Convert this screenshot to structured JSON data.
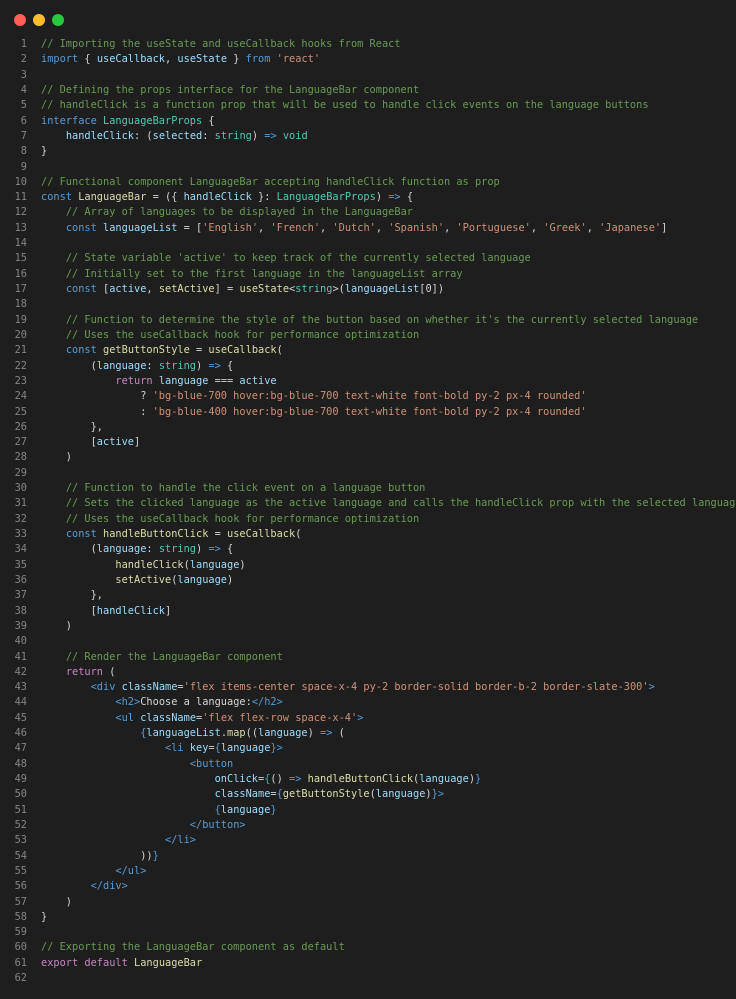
{
  "window": {
    "controls": [
      {
        "name": "close",
        "color": "#ff5f57"
      },
      {
        "name": "minimize",
        "color": "#febc2e"
      },
      {
        "name": "zoom",
        "color": "#28c840"
      }
    ]
  },
  "code": {
    "lines": [
      {
        "n": "1",
        "t": [
          [
            "c",
            "// Importing the useState and useCallback hooks from React"
          ]
        ]
      },
      {
        "n": "2",
        "t": [
          [
            "k",
            "import"
          ],
          [
            "p",
            " { "
          ],
          [
            "v",
            "useCallback"
          ],
          [
            "p",
            ", "
          ],
          [
            "v",
            "useState"
          ],
          [
            "p",
            " } "
          ],
          [
            "k",
            "from"
          ],
          [
            "p",
            " "
          ],
          [
            "s",
            "'react'"
          ]
        ]
      },
      {
        "n": "3",
        "t": []
      },
      {
        "n": "4",
        "t": [
          [
            "c",
            "// Defining the props interface for the LanguageBar component"
          ]
        ]
      },
      {
        "n": "5",
        "t": [
          [
            "c",
            "// handleClick is a function prop that will be used to handle click events on the language buttons"
          ]
        ]
      },
      {
        "n": "6",
        "t": [
          [
            "k",
            "interface"
          ],
          [
            "p",
            " "
          ],
          [
            "y",
            "LanguageBarProps"
          ],
          [
            "p",
            " {"
          ]
        ]
      },
      {
        "n": "7",
        "t": [
          [
            "p",
            "    "
          ],
          [
            "v",
            "handleClick"
          ],
          [
            "p",
            ": ("
          ],
          [
            "v",
            "selected"
          ],
          [
            "p",
            ": "
          ],
          [
            "y",
            "string"
          ],
          [
            "p",
            ") "
          ],
          [
            "k",
            "=>"
          ],
          [
            "p",
            " "
          ],
          [
            "y",
            "void"
          ]
        ]
      },
      {
        "n": "8",
        "t": [
          [
            "p",
            "}"
          ]
        ]
      },
      {
        "n": "9",
        "t": []
      },
      {
        "n": "10",
        "t": [
          [
            "c",
            "// Functional component LanguageBar accepting handleClick function as prop"
          ]
        ]
      },
      {
        "n": "11",
        "t": [
          [
            "k",
            "const"
          ],
          [
            "p",
            " "
          ],
          [
            "f",
            "LanguageBar"
          ],
          [
            "p",
            " = ({ "
          ],
          [
            "v",
            "handleClick"
          ],
          [
            "p",
            " }: "
          ],
          [
            "y",
            "LanguageBarProps"
          ],
          [
            "p",
            ") "
          ],
          [
            "k",
            "=>"
          ],
          [
            "p",
            " {"
          ]
        ]
      },
      {
        "n": "12",
        "t": [
          [
            "p",
            "    "
          ],
          [
            "c",
            "// Array of languages to be displayed in the LanguageBar"
          ]
        ]
      },
      {
        "n": "13",
        "t": [
          [
            "p",
            "    "
          ],
          [
            "k",
            "const"
          ],
          [
            "p",
            " "
          ],
          [
            "v",
            "languageList"
          ],
          [
            "p",
            " = ["
          ],
          [
            "s",
            "'English'"
          ],
          [
            "p",
            ", "
          ],
          [
            "s",
            "'French'"
          ],
          [
            "p",
            ", "
          ],
          [
            "s",
            "'Dutch'"
          ],
          [
            "p",
            ", "
          ],
          [
            "s",
            "'Spanish'"
          ],
          [
            "p",
            ", "
          ],
          [
            "s",
            "'Portuguese'"
          ],
          [
            "p",
            ", "
          ],
          [
            "s",
            "'Greek'"
          ],
          [
            "p",
            ", "
          ],
          [
            "s",
            "'Japanese'"
          ],
          [
            "p",
            "]"
          ]
        ]
      },
      {
        "n": "14",
        "t": []
      },
      {
        "n": "15",
        "t": [
          [
            "p",
            "    "
          ],
          [
            "c",
            "// State variable 'active' to keep track of the currently selected language"
          ]
        ]
      },
      {
        "n": "16",
        "t": [
          [
            "p",
            "    "
          ],
          [
            "c",
            "// Initially set to the first language in the languageList array"
          ]
        ]
      },
      {
        "n": "17",
        "t": [
          [
            "p",
            "    "
          ],
          [
            "k",
            "const"
          ],
          [
            "p",
            " ["
          ],
          [
            "v",
            "active"
          ],
          [
            "p",
            ", "
          ],
          [
            "f",
            "setActive"
          ],
          [
            "p",
            "] = "
          ],
          [
            "f",
            "useState"
          ],
          [
            "p",
            "<"
          ],
          [
            "y",
            "string"
          ],
          [
            "p",
            ">("
          ],
          [
            "v",
            "languageList"
          ],
          [
            "p",
            "[0])"
          ]
        ]
      },
      {
        "n": "18",
        "t": []
      },
      {
        "n": "19",
        "t": [
          [
            "p",
            "    "
          ],
          [
            "c",
            "// Function to determine the style of the button based on whether it's the currently selected language"
          ]
        ]
      },
      {
        "n": "20",
        "t": [
          [
            "p",
            "    "
          ],
          [
            "c",
            "// Uses the useCallback hook for performance optimization"
          ]
        ]
      },
      {
        "n": "21",
        "t": [
          [
            "p",
            "    "
          ],
          [
            "k",
            "const"
          ],
          [
            "p",
            " "
          ],
          [
            "f",
            "getButtonStyle"
          ],
          [
            "p",
            " = "
          ],
          [
            "f",
            "useCallback"
          ],
          [
            "p",
            "("
          ]
        ]
      },
      {
        "n": "22",
        "t": [
          [
            "p",
            "        ("
          ],
          [
            "v",
            "language"
          ],
          [
            "p",
            ": "
          ],
          [
            "y",
            "string"
          ],
          [
            "p",
            ") "
          ],
          [
            "k",
            "=>"
          ],
          [
            "p",
            " {"
          ]
        ]
      },
      {
        "n": "23",
        "t": [
          [
            "p",
            "            "
          ],
          [
            "x",
            "return"
          ],
          [
            "p",
            " "
          ],
          [
            "v",
            "language"
          ],
          [
            "p",
            " === "
          ],
          [
            "v",
            "active"
          ]
        ]
      },
      {
        "n": "24",
        "t": [
          [
            "p",
            "                ? "
          ],
          [
            "s",
            "'bg-blue-700 hover:bg-blue-700 text-white font-bold py-2 px-4 rounded'"
          ]
        ]
      },
      {
        "n": "25",
        "t": [
          [
            "p",
            "                : "
          ],
          [
            "s",
            "'bg-blue-400 hover:bg-blue-700 text-white font-bold py-2 px-4 rounded'"
          ]
        ]
      },
      {
        "n": "26",
        "t": [
          [
            "p",
            "        },"
          ]
        ]
      },
      {
        "n": "27",
        "t": [
          [
            "p",
            "        ["
          ],
          [
            "v",
            "active"
          ],
          [
            "p",
            "]"
          ]
        ]
      },
      {
        "n": "28",
        "t": [
          [
            "p",
            "    )"
          ]
        ]
      },
      {
        "n": "29",
        "t": []
      },
      {
        "n": "30",
        "t": [
          [
            "p",
            "    "
          ],
          [
            "c",
            "// Function to handle the click event on a language button"
          ]
        ]
      },
      {
        "n": "31",
        "t": [
          [
            "p",
            "    "
          ],
          [
            "c",
            "// Sets the clicked language as the active language and calls the handleClick prop with the selected language"
          ]
        ]
      },
      {
        "n": "32",
        "t": [
          [
            "p",
            "    "
          ],
          [
            "c",
            "// Uses the useCallback hook for performance optimization"
          ]
        ]
      },
      {
        "n": "33",
        "t": [
          [
            "p",
            "    "
          ],
          [
            "k",
            "const"
          ],
          [
            "p",
            " "
          ],
          [
            "f",
            "handleButtonClick"
          ],
          [
            "p",
            " = "
          ],
          [
            "f",
            "useCallback"
          ],
          [
            "p",
            "("
          ]
        ]
      },
      {
        "n": "34",
        "t": [
          [
            "p",
            "        ("
          ],
          [
            "v",
            "language"
          ],
          [
            "p",
            ": "
          ],
          [
            "y",
            "string"
          ],
          [
            "p",
            ") "
          ],
          [
            "k",
            "=>"
          ],
          [
            "p",
            " {"
          ]
        ]
      },
      {
        "n": "35",
        "t": [
          [
            "p",
            "            "
          ],
          [
            "f",
            "handleClick"
          ],
          [
            "p",
            "("
          ],
          [
            "v",
            "language"
          ],
          [
            "p",
            ")"
          ]
        ]
      },
      {
        "n": "36",
        "t": [
          [
            "p",
            "            "
          ],
          [
            "f",
            "setActive"
          ],
          [
            "p",
            "("
          ],
          [
            "v",
            "language"
          ],
          [
            "p",
            ")"
          ]
        ]
      },
      {
        "n": "37",
        "t": [
          [
            "p",
            "        },"
          ]
        ]
      },
      {
        "n": "38",
        "t": [
          [
            "p",
            "        ["
          ],
          [
            "v",
            "handleClick"
          ],
          [
            "p",
            "]"
          ]
        ]
      },
      {
        "n": "39",
        "t": [
          [
            "p",
            "    )"
          ]
        ]
      },
      {
        "n": "40",
        "t": []
      },
      {
        "n": "41",
        "t": [
          [
            "p",
            "    "
          ],
          [
            "c",
            "// Render the LanguageBar component"
          ]
        ]
      },
      {
        "n": "42",
        "t": [
          [
            "p",
            "    "
          ],
          [
            "x",
            "return"
          ],
          [
            "p",
            " ("
          ]
        ]
      },
      {
        "n": "43",
        "t": [
          [
            "p",
            "        "
          ],
          [
            "g",
            "<div"
          ],
          [
            "p",
            " "
          ],
          [
            "a",
            "className"
          ],
          [
            "p",
            "="
          ],
          [
            "s",
            "'flex items-center space-x-4 py-2 border-solid border-b-2 border-slate-300'"
          ],
          [
            "g",
            ">"
          ]
        ]
      },
      {
        "n": "44",
        "t": [
          [
            "p",
            "            "
          ],
          [
            "g",
            "<h2>"
          ],
          [
            "p",
            "Choose a language:"
          ],
          [
            "g",
            "</h2>"
          ]
        ]
      },
      {
        "n": "45",
        "t": [
          [
            "p",
            "            "
          ],
          [
            "g",
            "<ul"
          ],
          [
            "p",
            " "
          ],
          [
            "a",
            "className"
          ],
          [
            "p",
            "="
          ],
          [
            "s",
            "'flex flex-row space-x-4'"
          ],
          [
            "g",
            ">"
          ]
        ]
      },
      {
        "n": "46",
        "t": [
          [
            "p",
            "                "
          ],
          [
            "b",
            "{"
          ],
          [
            "v",
            "languageList"
          ],
          [
            "p",
            "."
          ],
          [
            "f",
            "map"
          ],
          [
            "p",
            "(("
          ],
          [
            "v",
            "language"
          ],
          [
            "p",
            ") "
          ],
          [
            "k",
            "=>"
          ],
          [
            "p",
            " ("
          ]
        ]
      },
      {
        "n": "47",
        "t": [
          [
            "p",
            "                    "
          ],
          [
            "g",
            "<li"
          ],
          [
            "p",
            " "
          ],
          [
            "a",
            "key"
          ],
          [
            "p",
            "="
          ],
          [
            "b",
            "{"
          ],
          [
            "v",
            "language"
          ],
          [
            "b",
            "}"
          ],
          [
            "g",
            ">"
          ]
        ]
      },
      {
        "n": "48",
        "t": [
          [
            "p",
            "                        "
          ],
          [
            "g",
            "<button"
          ]
        ]
      },
      {
        "n": "49",
        "t": [
          [
            "p",
            "                            "
          ],
          [
            "a",
            "onClick"
          ],
          [
            "p",
            "="
          ],
          [
            "b",
            "{"
          ],
          [
            "p",
            "() "
          ],
          [
            "k",
            "=>"
          ],
          [
            "p",
            " "
          ],
          [
            "f",
            "handleButtonClick"
          ],
          [
            "p",
            "("
          ],
          [
            "v",
            "language"
          ],
          [
            "p",
            ")"
          ],
          [
            "b",
            "}"
          ]
        ]
      },
      {
        "n": "50",
        "t": [
          [
            "p",
            "                            "
          ],
          [
            "a",
            "className"
          ],
          [
            "p",
            "="
          ],
          [
            "b",
            "{"
          ],
          [
            "f",
            "getButtonStyle"
          ],
          [
            "p",
            "("
          ],
          [
            "v",
            "language"
          ],
          [
            "p",
            ")"
          ],
          [
            "b",
            "}"
          ],
          [
            "g",
            ">"
          ]
        ]
      },
      {
        "n": "51",
        "t": [
          [
            "p",
            "                            "
          ],
          [
            "b",
            "{"
          ],
          [
            "v",
            "language"
          ],
          [
            "b",
            "}"
          ]
        ]
      },
      {
        "n": "52",
        "t": [
          [
            "p",
            "                        "
          ],
          [
            "g",
            "</button>"
          ]
        ]
      },
      {
        "n": "53",
        "t": [
          [
            "p",
            "                    "
          ],
          [
            "g",
            "</li>"
          ]
        ]
      },
      {
        "n": "54",
        "t": [
          [
            "p",
            "                ))"
          ],
          [
            "b",
            "}"
          ]
        ]
      },
      {
        "n": "55",
        "t": [
          [
            "p",
            "            "
          ],
          [
            "g",
            "</ul>"
          ]
        ]
      },
      {
        "n": "56",
        "t": [
          [
            "p",
            "        "
          ],
          [
            "g",
            "</div>"
          ]
        ]
      },
      {
        "n": "57",
        "t": [
          [
            "p",
            "    )"
          ]
        ]
      },
      {
        "n": "58",
        "t": [
          [
            "p",
            "}"
          ]
        ]
      },
      {
        "n": "59",
        "t": []
      },
      {
        "n": "60",
        "t": [
          [
            "c",
            "// Exporting the LanguageBar component as default"
          ]
        ]
      },
      {
        "n": "61",
        "t": [
          [
            "x",
            "export"
          ],
          [
            "p",
            " "
          ],
          [
            "x",
            "default"
          ],
          [
            "p",
            " "
          ],
          [
            "f",
            "LanguageBar"
          ]
        ]
      },
      {
        "n": "62",
        "t": []
      }
    ]
  }
}
